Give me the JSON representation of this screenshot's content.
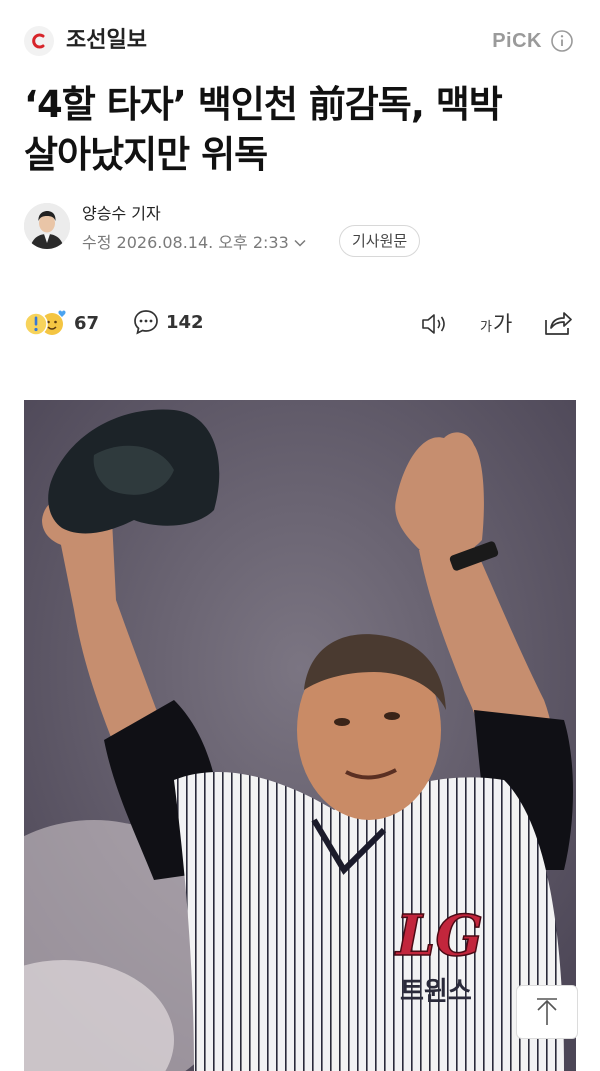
{
  "header": {
    "press_name": "조선일보",
    "pick_label": "PiCK"
  },
  "article": {
    "title_line1": "‘4할 타자’ 백인천 前감독, 맥박",
    "title_line2": "살아났지만 위독"
  },
  "reporter": {
    "name": "양승수 기자",
    "date": "수정 2026.08.14. 오후 2:33",
    "original_label": "기사원문"
  },
  "actions": {
    "reaction_count": "67",
    "comment_count": "142",
    "font_small": "가",
    "font_big": "가"
  },
  "photo": {
    "jersey_logo": "LG",
    "jersey_team": "트윈스"
  },
  "colors": {
    "brand_red": "#d7242a",
    "text_dark": "#111111",
    "text_gray": "#7a7a7a",
    "pick_gray": "#9a9a9a"
  }
}
